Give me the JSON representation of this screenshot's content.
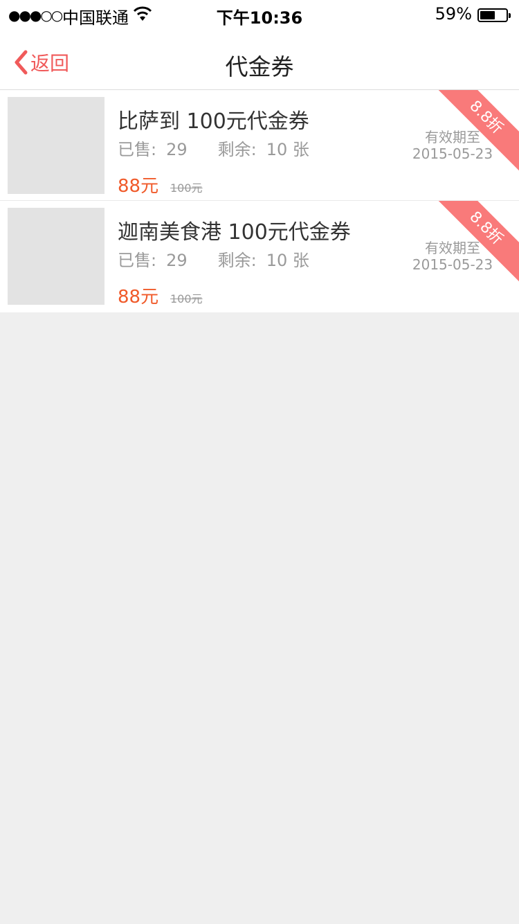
{
  "status_bar": {
    "signal": "●●●○○",
    "carrier": "中国联通",
    "time": "下午10:36",
    "battery_percent": "59%",
    "battery_level": 0.59
  },
  "navbar": {
    "back_label": "返回",
    "title": "代金券",
    "accent": "#f05a5a"
  },
  "vouchers": [
    {
      "name": "比萨到 100元代金券",
      "sold_label": "已售:",
      "sold": "29",
      "remain_label": "剩余:",
      "remain": "10 张",
      "price": "88元",
      "original_price": "100元",
      "valid_label": "有效期至",
      "valid_date": "2015-05-23",
      "discount": "8.8折"
    },
    {
      "name": "迦南美食港 100元代金券",
      "sold_label": "已售:",
      "sold": "29",
      "remain_label": "剩余:",
      "remain": "10 张",
      "price": "88元",
      "original_price": "100元",
      "valid_label": "有效期至",
      "valid_date": "2015-05-23",
      "discount": "8.8折"
    }
  ],
  "colors": {
    "price": "#f05a2a",
    "ribbon": "#f97a7a",
    "background": "#efefef"
  }
}
